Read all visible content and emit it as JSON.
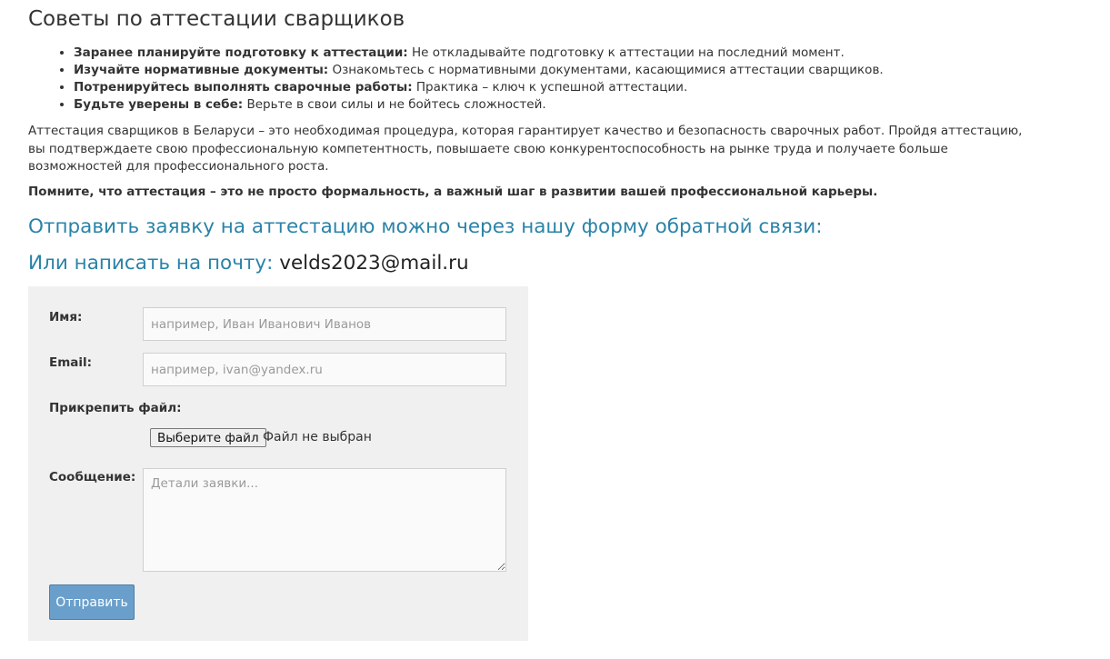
{
  "tips": {
    "title": "Советы по аттестации сварщиков",
    "items": [
      {
        "bold": "Заранее планируйте подготовку к аттестации:",
        "text": " Не откладывайте подготовку к аттестации на последний момент."
      },
      {
        "bold": "Изучайте нормативные документы:",
        "text": " Ознакомьтесь с нормативными документами, касающимися аттестации сварщиков."
      },
      {
        "bold": "Потренируйтесь выполнять сварочные работы:",
        "text": " Практика – ключ к успешной аттестации."
      },
      {
        "bold": "Будьте уверены в себе:",
        "text": " Верьте в свои силы и не бойтесь сложностей."
      }
    ]
  },
  "intro": "Аттестация сварщиков в Беларуси – это необходимая процедура, которая гарантирует качество и безопасность сварочных работ. Пройдя аттестацию, вы подтверждаете свою профессиональную компетентность, повышаете свою конкурентоспособность на рынке труда и получаете больше возможностей для профессионального роста.",
  "remember": "Помните, что аттестация – это не просто формальность, а важный шаг в развитии вашей профессиональной карьеры.",
  "cta": "Отправить заявку на аттестацию можно через нашу форму обратной связи:",
  "mail": {
    "label": "Или написать на почту: ",
    "address": "velds2023@mail.ru"
  },
  "form": {
    "name_label": "Имя:",
    "name_placeholder": "например, Иван Иванович Иванов",
    "email_label": "Email:",
    "email_placeholder": "например, ivan@yandex.ru",
    "file_label": "Прикрепить файл:",
    "file_button": "Выберите файл",
    "file_status": "Файл не выбран",
    "message_label": "Сообщение:",
    "message_placeholder": "Детали заявки...",
    "submit_label": "Отправить"
  }
}
